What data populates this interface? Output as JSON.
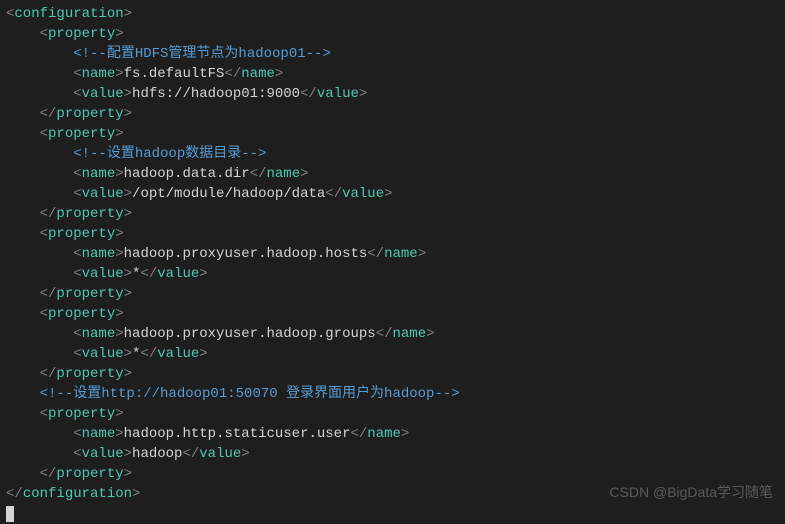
{
  "lines": [
    {
      "indent": 0,
      "type": "open",
      "tag": "configuration"
    },
    {
      "indent": 1,
      "type": "open",
      "tag": "property"
    },
    {
      "indent": 2,
      "type": "comment",
      "text": "配置HDFS管理节点为hadoop01"
    },
    {
      "indent": 2,
      "type": "pair",
      "tag": "name",
      "value": "fs.defaultFS"
    },
    {
      "indent": 2,
      "type": "pair",
      "tag": "value",
      "value": "hdfs://hadoop01:9000"
    },
    {
      "indent": 1,
      "type": "close",
      "tag": "property"
    },
    {
      "indent": 1,
      "type": "open",
      "tag": "property"
    },
    {
      "indent": 2,
      "type": "comment",
      "text": "设置hadoop数据目录"
    },
    {
      "indent": 2,
      "type": "pair",
      "tag": "name",
      "value": "hadoop.data.dir"
    },
    {
      "indent": 2,
      "type": "pair",
      "tag": "value",
      "value": "/opt/module/hadoop/data"
    },
    {
      "indent": 1,
      "type": "close",
      "tag": "property"
    },
    {
      "indent": 1,
      "type": "open",
      "tag": "property"
    },
    {
      "indent": 2,
      "type": "pair",
      "tag": "name",
      "value": "hadoop.proxyuser.hadoop.hosts"
    },
    {
      "indent": 2,
      "type": "pair",
      "tag": "value",
      "value": "*"
    },
    {
      "indent": 1,
      "type": "close",
      "tag": "property"
    },
    {
      "indent": 1,
      "type": "open",
      "tag": "property"
    },
    {
      "indent": 2,
      "type": "pair",
      "tag": "name",
      "value": "hadoop.proxyuser.hadoop.groups"
    },
    {
      "indent": 2,
      "type": "pair",
      "tag": "value",
      "value": "*"
    },
    {
      "indent": 1,
      "type": "close",
      "tag": "property"
    },
    {
      "indent": 1,
      "type": "comment",
      "text": "设置http://hadoop01:50070 登录界面用户为hadoop"
    },
    {
      "indent": 1,
      "type": "open",
      "tag": "property"
    },
    {
      "indent": 2,
      "type": "pair",
      "tag": "name",
      "value": "hadoop.http.staticuser.user"
    },
    {
      "indent": 2,
      "type": "pair",
      "tag": "value",
      "value": "hadoop"
    },
    {
      "indent": 1,
      "type": "close",
      "tag": "property"
    },
    {
      "indent": 0,
      "type": "close",
      "tag": "configuration"
    }
  ],
  "watermark": "CSDN @BigData学习随笔",
  "indentUnit": "    "
}
